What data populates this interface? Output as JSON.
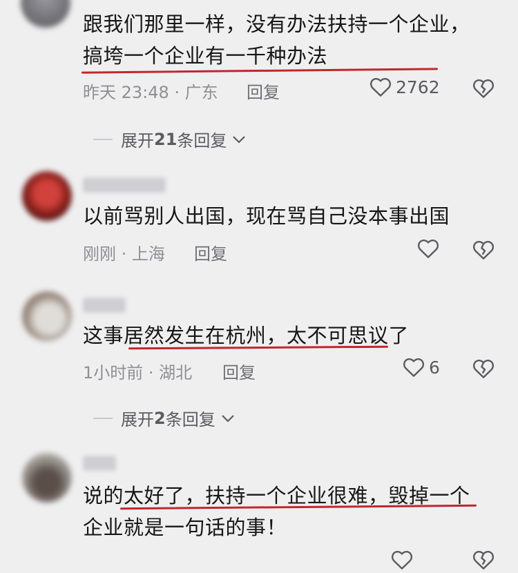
{
  "comments": [
    {
      "text_lines": [
        "跟我们那里一样，没有办法扶持一个企业，",
        "搞垮一个企业有一千种办法"
      ],
      "meta": "昨天 23:48 · 广东",
      "reply_label": "回复",
      "likes": "2762"
    },
    {
      "text_lines": [
        "以前骂别人出国，现在骂自己没本事出国"
      ],
      "meta": "刚刚 · 上海",
      "reply_label": "回复",
      "likes": ""
    },
    {
      "text_lines": [
        "这事居然发生在杭州，太不可思议了"
      ],
      "meta": "1小时前 · 湖北",
      "reply_label": "回复",
      "likes": "6"
    },
    {
      "text_lines": [
        "说的太好了，扶持一个企业很难，毁掉一个",
        "企业就是一句话的事！"
      ],
      "meta": "",
      "reply_label": "",
      "likes": ""
    }
  ],
  "expands": [
    {
      "label_pre": "展开 ",
      "count": "21",
      "label_post": " 条回复"
    },
    {
      "label_pre": "展开 ",
      "count": "2",
      "label_post": " 条回复"
    }
  ],
  "icons": {
    "like": "heart-outline-icon",
    "dislike": "broken-heart-icon",
    "expand": "chevron-down-icon"
  },
  "colors": {
    "underline": "#c0272d",
    "meta": "#8f8f94"
  }
}
